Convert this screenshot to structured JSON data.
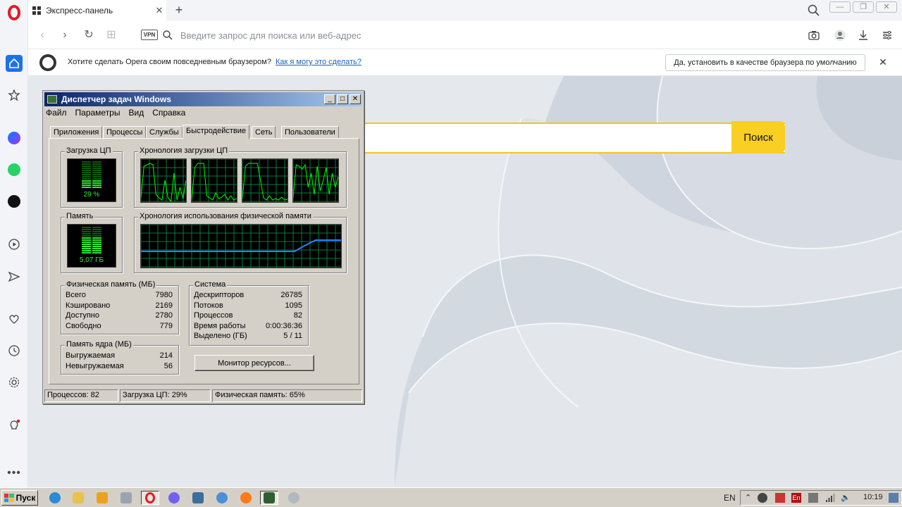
{
  "browser": {
    "tab_title": "Экспресс-панель",
    "address_placeholder": "Введите запрос для поиска или веб-адрес",
    "vpn_label": "VPN",
    "default_bar": {
      "question": "Хотите сделать Opera своим повседневным браузером?",
      "how_link": "Как я могу это сделать?",
      "set_default_button": "Да, установить в качестве браузера по умолчанию"
    },
    "search_button": "Поиск"
  },
  "taskmgr": {
    "title": "Диспетчер задач Windows",
    "menu": [
      "Файл",
      "Параметры",
      "Вид",
      "Справка"
    ],
    "tabs": [
      "Приложения",
      "Процессы",
      "Службы",
      "Быстродействие",
      "Сеть",
      "Пользователи"
    ],
    "active_tab": "Быстродействие",
    "cpu": {
      "label": "Загрузка ЦП",
      "value": "29 %",
      "percent": 29
    },
    "cpu_history_label": "Хронология загрузки ЦП",
    "memory": {
      "label": "Память",
      "value": "5,07 ГБ",
      "percent": 65
    },
    "memory_history_label": "Хронология использования физической памяти",
    "physical_memory": {
      "label": "Физическая память (МБ)",
      "rows": [
        {
          "k": "Всего",
          "v": "7980"
        },
        {
          "k": "Кэшировано",
          "v": "2169"
        },
        {
          "k": "Доступно",
          "v": "2780"
        },
        {
          "k": "Свободно",
          "v": "779"
        }
      ]
    },
    "kernel_memory": {
      "label": "Память ядра (МБ)",
      "rows": [
        {
          "k": "Выгружаемая",
          "v": "214"
        },
        {
          "k": "Невыгружаемая",
          "v": "56"
        }
      ]
    },
    "system": {
      "label": "Система",
      "rows": [
        {
          "k": "Дескрипторов",
          "v": "26785"
        },
        {
          "k": "Потоков",
          "v": "1095"
        },
        {
          "k": "Процессов",
          "v": "82"
        },
        {
          "k": "Время работы",
          "v": "0:00:36:36"
        },
        {
          "k": "Выделено (ГБ)",
          "v": "5 / 11"
        }
      ]
    },
    "monitor_button": "Монитор ресурсов...",
    "status": [
      "Процессов: 82",
      "Загрузка ЦП: 29%",
      "Физическая память: 65%"
    ]
  },
  "taskbar": {
    "start_label": "Пуск",
    "lang": "EN",
    "clock": "10:19"
  },
  "colors": {
    "accent_yellow": "#f8cf22",
    "meter_green": "#2ee82e",
    "graph_green": "#00ff00",
    "grid_green": "#0a7a3a",
    "mem_line_blue": "#2a7fff",
    "opera_red": "#e01b22"
  }
}
